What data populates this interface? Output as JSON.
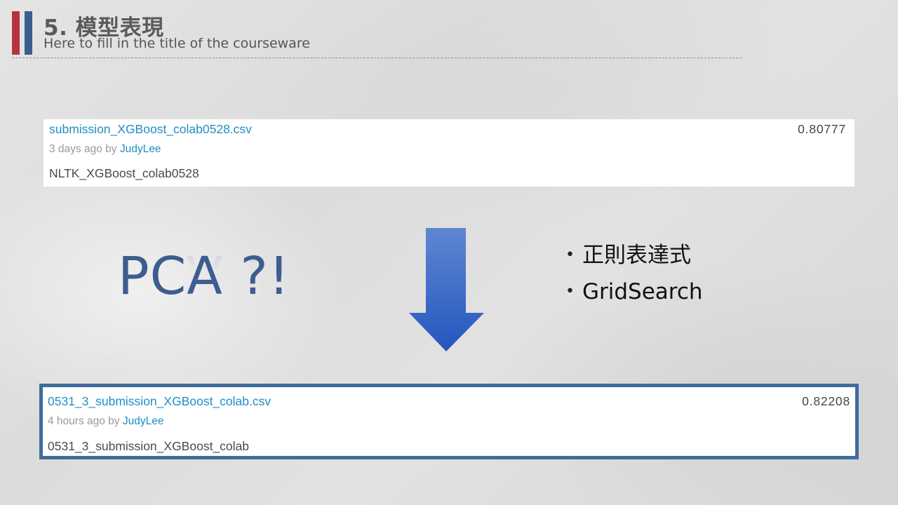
{
  "header": {
    "title": "5. 模型表現",
    "subtitle": "Here to fill in the title of the courseware"
  },
  "submission_before": {
    "file_name": "submission_XGBoost_colab0528.csv",
    "score": "0.80777",
    "time_text": "3 days ago by ",
    "author": "JudyLee",
    "description": "NLTK_XGBoost_colab0528"
  },
  "submission_after": {
    "file_name": "0531_3_submission_XGBoost_colab.csv",
    "score": "0.82208",
    "time_text": "4 hours ago by ",
    "author": "JudyLee",
    "description": "0531_3_submission_XGBoost_colab"
  },
  "pca_text": "PCA ?!",
  "bullets": [
    "正則表達式",
    "GridSearch"
  ],
  "colors": {
    "accent_red": "#b5333c",
    "accent_blue": "#3b5e8e",
    "link": "#1f8fc4",
    "highlight_border": "#3f6c9b",
    "arrow": "#3a6bc4"
  },
  "icons": {
    "arrow": "down-arrow-icon"
  }
}
